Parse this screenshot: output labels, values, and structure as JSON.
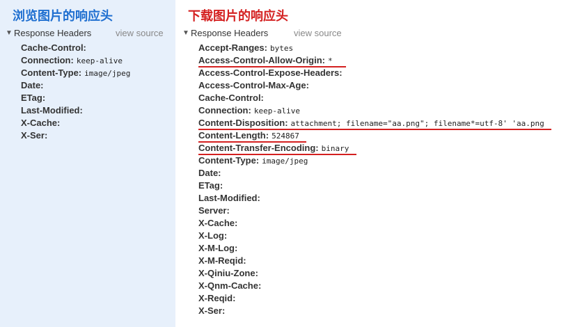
{
  "colors": {
    "left_bg": "#e7f0fb",
    "title_blue": "#1f6fd0",
    "title_red": "#d42020",
    "underline": "#d42020"
  },
  "left": {
    "title": "浏览图片的响应头",
    "section_label": "Response Headers",
    "view_source": "view source",
    "headers": [
      {
        "name": "Cache-Control:",
        "value": ""
      },
      {
        "name": "Connection:",
        "value": "keep-alive"
      },
      {
        "name": "Content-Type:",
        "value": "image/jpeg"
      },
      {
        "name": "Date:",
        "value": ""
      },
      {
        "name": "ETag:",
        "value": ""
      },
      {
        "name": "Last-Modified:",
        "value": ""
      },
      {
        "name": "X-Cache:",
        "value": ""
      },
      {
        "name": "X-Ser:",
        "value": ""
      }
    ]
  },
  "right": {
    "title": "下载图片的响应头",
    "section_label": "Response Headers",
    "view_source": "view source",
    "headers": [
      {
        "name": "Accept-Ranges:",
        "value": "bytes"
      },
      {
        "name": "Access-Control-Allow-Origin:",
        "value": "*",
        "highlight": true
      },
      {
        "name": "Access-Control-Expose-Headers:",
        "value": ""
      },
      {
        "name": "Access-Control-Max-Age:",
        "value": ""
      },
      {
        "name": "Cache-Control:",
        "value": ""
      },
      {
        "name": "Connection:",
        "value": "keep-alive"
      },
      {
        "name": "Content-Disposition:",
        "value": "attachment; filename=\"aa.png\"; filename*=utf-8' 'aa.png",
        "highlight": true
      },
      {
        "name": "Content-Length:",
        "value": "524867",
        "highlight": true
      },
      {
        "name": "Content-Transfer-Encoding:",
        "value": "binary",
        "highlight": true
      },
      {
        "name": "Content-Type:",
        "value": "image/jpeg"
      },
      {
        "name": "Date:",
        "value": ""
      },
      {
        "name": "ETag:",
        "value": ""
      },
      {
        "name": "Last-Modified:",
        "value": ""
      },
      {
        "name": "Server:",
        "value": ""
      },
      {
        "name": "X-Cache:",
        "value": ""
      },
      {
        "name": "X-Log:",
        "value": ""
      },
      {
        "name": "X-M-Log:",
        "value": ""
      },
      {
        "name": "X-M-Reqid:",
        "value": ""
      },
      {
        "name": "X-Qiniu-Zone:",
        "value": ""
      },
      {
        "name": "X-Qnm-Cache:",
        "value": ""
      },
      {
        "name": "X-Reqid:",
        "value": ""
      },
      {
        "name": "X-Ser:",
        "value": ""
      }
    ]
  }
}
